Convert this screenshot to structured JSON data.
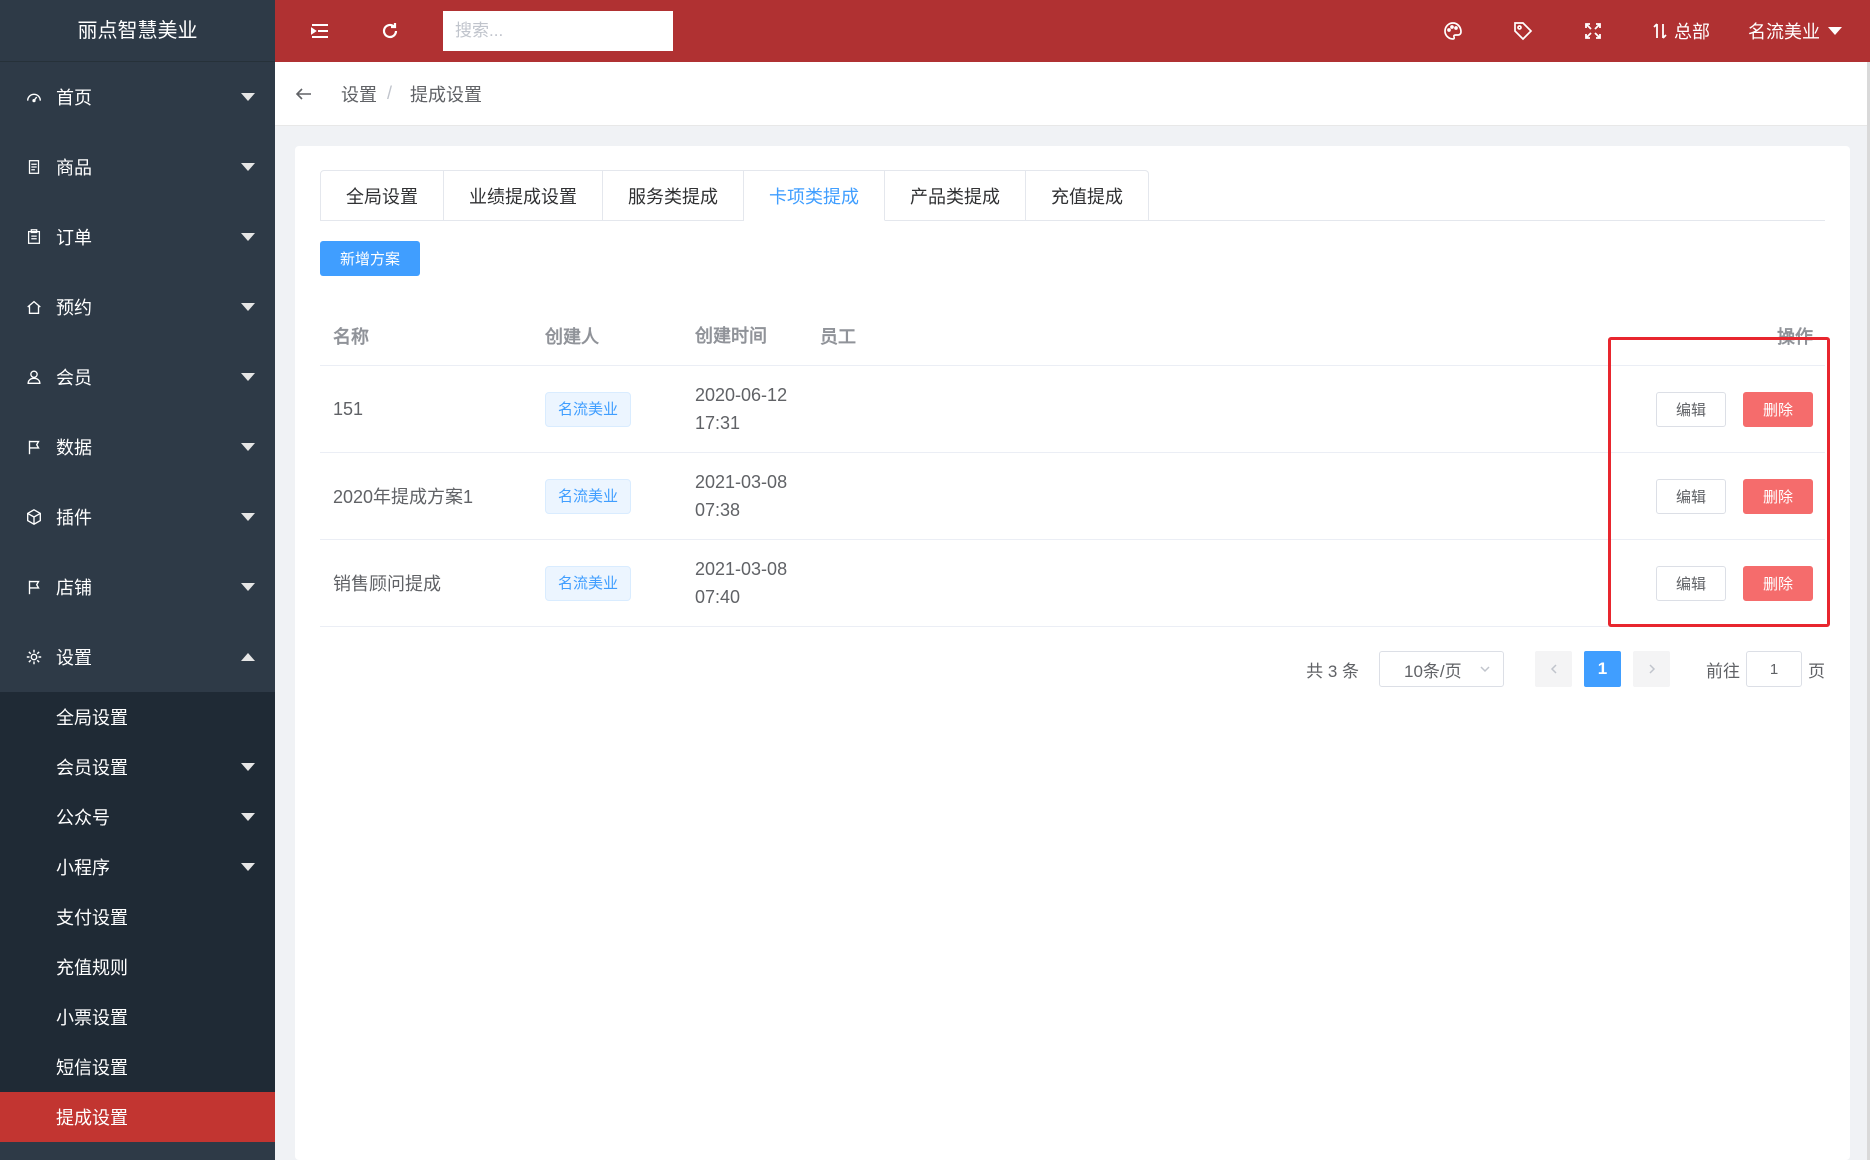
{
  "brand": "丽点智慧美业",
  "search": {
    "placeholder": "搜索..."
  },
  "topbar": {
    "hq_label": "总部",
    "user_label": "名流美业"
  },
  "sidebar": {
    "items": [
      {
        "label": "首页",
        "icon": "dashboard-icon"
      },
      {
        "label": "商品",
        "icon": "document-icon"
      },
      {
        "label": "订单",
        "icon": "clipboard-icon"
      },
      {
        "label": "预约",
        "icon": "home-icon"
      },
      {
        "label": "会员",
        "icon": "user-icon"
      },
      {
        "label": "数据",
        "icon": "flag-icon"
      },
      {
        "label": "插件",
        "icon": "cube-icon"
      },
      {
        "label": "店铺",
        "icon": "flag-icon"
      },
      {
        "label": "设置",
        "icon": "gear-icon"
      }
    ],
    "submenu": [
      {
        "label": "全局设置"
      },
      {
        "label": "会员设置"
      },
      {
        "label": "公众号"
      },
      {
        "label": "小程序"
      },
      {
        "label": "支付设置"
      },
      {
        "label": "充值规则"
      },
      {
        "label": "小票设置"
      },
      {
        "label": "短信设置"
      },
      {
        "label": "提成设置"
      }
    ]
  },
  "breadcrumb": {
    "parent": "设置",
    "current": "提成设置"
  },
  "tabs": [
    "全局设置",
    "业绩提成设置",
    "服务类提成",
    "卡项类提成",
    "产品类提成",
    "充值提成"
  ],
  "active_tab": "卡项类提成",
  "add_button": "新增方案",
  "table": {
    "headers": {
      "name": "名称",
      "creator": "创建人",
      "time": "创建时间",
      "staff": "员工",
      "ops": "操作"
    },
    "rows": [
      {
        "name": "151",
        "creator": "名流美业",
        "date": "2020-06-12",
        "clock": "17:31"
      },
      {
        "name": "2020年提成方案1",
        "creator": "名流美业",
        "date": "2021-03-08",
        "clock": "07:38"
      },
      {
        "name": "销售顾问提成",
        "creator": "名流美业",
        "date": "2021-03-08",
        "clock": "07:40"
      }
    ],
    "edit_label": "编辑",
    "delete_label": "删除"
  },
  "pagination": {
    "total": "共 3 条",
    "page_size": "10条/页",
    "current_page": "1",
    "goto_label": "前往",
    "goto_value": "1",
    "page_unit": "页"
  },
  "colors": {
    "sidebar_bg": "#2e3a47",
    "topbar_bg": "#b03132",
    "active_menu": "#c23531",
    "primary": "#409eff",
    "danger": "#f56c6c",
    "highlight": "#e8262e"
  }
}
